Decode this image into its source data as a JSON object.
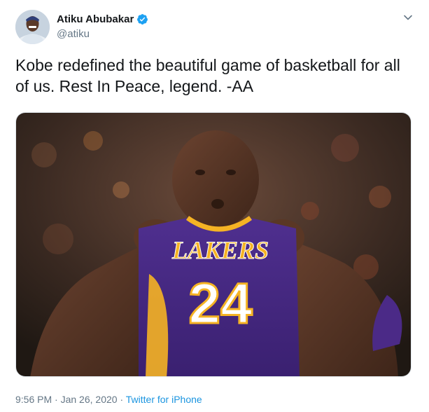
{
  "author": {
    "display_name": "Atiku Abubakar",
    "handle": "@atiku",
    "verified": true,
    "avatar_icon": "profile-photo"
  },
  "tweet": {
    "text": "Kobe redefined the beautiful game of basketball for all of us. Rest In Peace, legend. -AA"
  },
  "media": {
    "jersey_team": "LAKERS",
    "jersey_number": "24"
  },
  "meta": {
    "time": "9:56 PM",
    "separator1": " · ",
    "date": "Jan 26, 2020",
    "separator2": " · ",
    "source": "Twitter for iPhone"
  },
  "colors": {
    "link": "#1b95e0",
    "secondary_text": "#657786",
    "lakers_purple": "#4b2a87",
    "lakers_gold": "#f5b324"
  },
  "icons": {
    "verified": "verified-badge-icon",
    "menu": "chevron-down-icon"
  }
}
